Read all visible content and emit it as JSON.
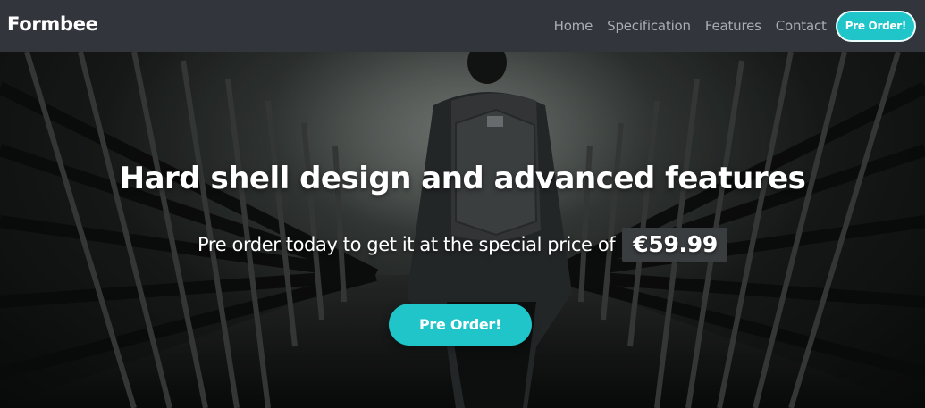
{
  "navbar": {
    "brand": "Formbee",
    "links": [
      "Home",
      "Specification",
      "Features",
      "Contact"
    ],
    "cta_label": "Pre Order!"
  },
  "hero": {
    "title": "Hard shell design and advanced features",
    "subtitle": "Pre order today to get it at the special price of",
    "price": "€59.99",
    "cta_label": "Pre Order!"
  },
  "colors": {
    "accent": "#1fc5c9",
    "navbar_bg": "#32363c",
    "nav_link": "#a9adb3",
    "price_badge_bg": "#3a3d40"
  }
}
